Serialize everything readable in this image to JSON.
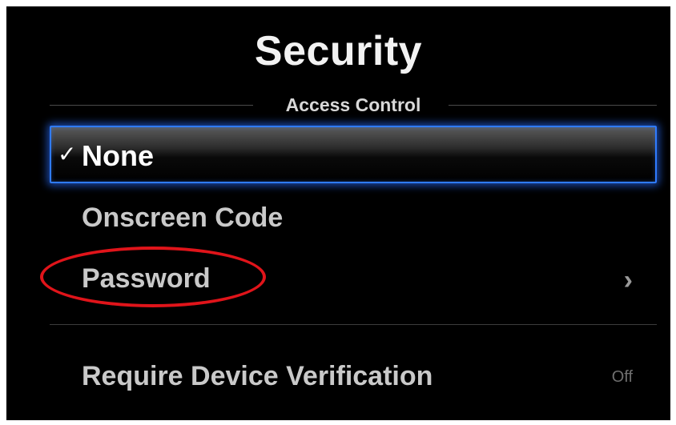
{
  "header": {
    "title": "Security"
  },
  "access_control": {
    "section_label": "Access Control",
    "options": [
      {
        "label": "None",
        "selected": true,
        "check_icon": "✓",
        "icon": "checkmark-icon"
      },
      {
        "label": "Onscreen Code",
        "selected": false
      },
      {
        "label": "Password",
        "selected": false,
        "chevron_icon": "›",
        "icon": "chevron-right-icon"
      }
    ]
  },
  "settings": {
    "require_device_verification": {
      "label": "Require Device Verification",
      "value": "Off"
    }
  },
  "colors": {
    "background": "#000000",
    "focus_border": "#2f7bff",
    "annotation": "#e0141a",
    "text_primary": "#ffffff",
    "text_secondary": "#c9c9c9"
  }
}
